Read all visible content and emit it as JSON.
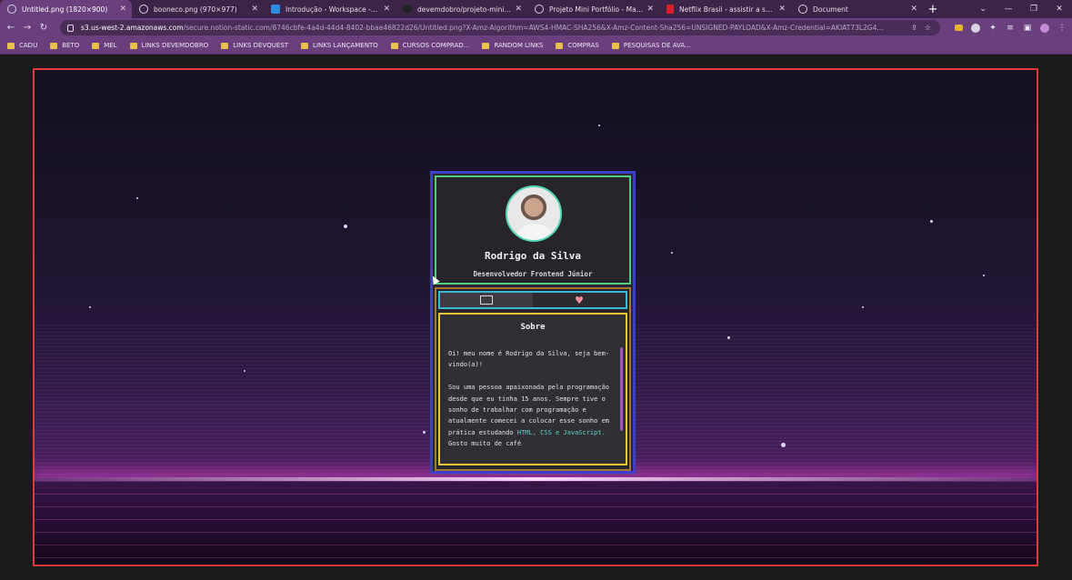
{
  "browser": {
    "tabs": [
      {
        "title": "Untitled.png (1820×900)",
        "icon": "globe-icon",
        "active": true
      },
      {
        "title": "booneco.png (970×977)",
        "icon": "globe-icon",
        "active": false
      },
      {
        "title": "Introdução - Workspace - Visua",
        "icon": "vscode-icon",
        "active": false
      },
      {
        "title": "devemdobro/projeto-mini-port",
        "icon": "github-icon",
        "active": false
      },
      {
        "title": "Projeto Mini Portfólio - MapaD",
        "icon": "globe-icon",
        "active": false
      },
      {
        "title": "Netflix Brasil - assistir a séries o",
        "icon": "netflix-icon",
        "active": false
      },
      {
        "title": "Document",
        "icon": "globe-icon",
        "active": false
      }
    ],
    "new_tab": "+",
    "url_host": "s3.us-west-2.amazonaws.com",
    "url_path": "/secure.notion-static.com/8746cbfe-4a4d-44d4-8402-bbae46822d26/Untitled.png?X-Amz-Algorithm=AWS4-HMAC-SHA256&X-Amz-Content-Sha256=UNSIGNED-PAYLOAD&X-Amz-Credential=AKIAT73L2G4..."
  },
  "bookmarks": [
    "CADU",
    "BETO",
    "MEL",
    "LINKS DEVEMDOBRO",
    "LINKS DEVQUEST",
    "LINKS LANÇAMENTO",
    "CURSOS COMPRAD...",
    "RANDOM LINKS",
    "COMPRAS",
    "PESQUISAS DE AVA..."
  ],
  "profile": {
    "name": "Rodrigo da Silva",
    "role": "Desenvolvedor Frontend Júnior"
  },
  "about": {
    "title": "Sobre",
    "p1": "Oi! meu nome é Rodrigo da Silva, seja bem-vindo(a)!",
    "p2_start": "Sou uma pessoa apaixonada pela programação desde que eu tinha 15 anos. Sempre tive o sonho de trabalhar com programação e atualmente comecei a colocar esse sonho em prática estudando ",
    "p2_kw": "HTML, CSS e JavaScript.",
    "p2_end": " Gosto muito de café"
  },
  "colors": {
    "frame_border": "#e23a3a",
    "card_border": "#3b3fc9",
    "profile_border": "#4fd07f",
    "tabs_border": "#3ab9d6",
    "about_border": "#e6c93a"
  }
}
